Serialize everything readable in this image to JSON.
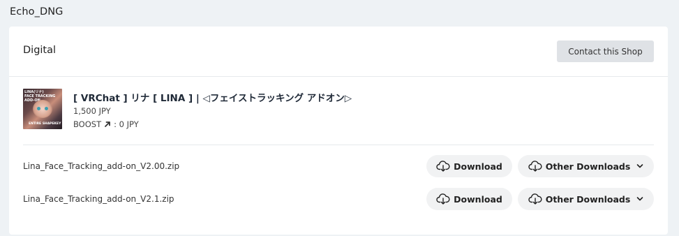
{
  "shop": {
    "name": "Echo_DNG"
  },
  "section": {
    "title": "Digital",
    "contact_label": "Contact this Shop"
  },
  "product": {
    "title": "[ VRChat ] リナ [ LINA ] | ◁フェイストラッキング アドオン▷",
    "price": "1,500 JPY",
    "boost_label": "BOOST",
    "boost_value": ": 0 JPY",
    "thumbnail": {
      "top_text": "LINA(リナ)",
      "sub_text": "FACE TRACKING ADD-ON",
      "bottom_text": "ENTIRE SHAPEKEY"
    }
  },
  "files": [
    {
      "name": "Lina_Face_Tracking_add-on_V2.00.zip",
      "download_label": "Download",
      "other_label": "Other Downloads"
    },
    {
      "name": "Lina_Face_Tracking_add-on_V2.1.zip",
      "download_label": "Download",
      "other_label": "Other Downloads"
    }
  ],
  "icons": {
    "download": "cloud-download-icon",
    "chevron": "chevron-down-icon",
    "boost": "arrow-up-right-icon"
  },
  "colors": {
    "page_bg": "#eef2f5",
    "card_bg": "#ffffff",
    "contact_bg": "#dfe2e6",
    "pill_bg": "#f1f2f3"
  }
}
